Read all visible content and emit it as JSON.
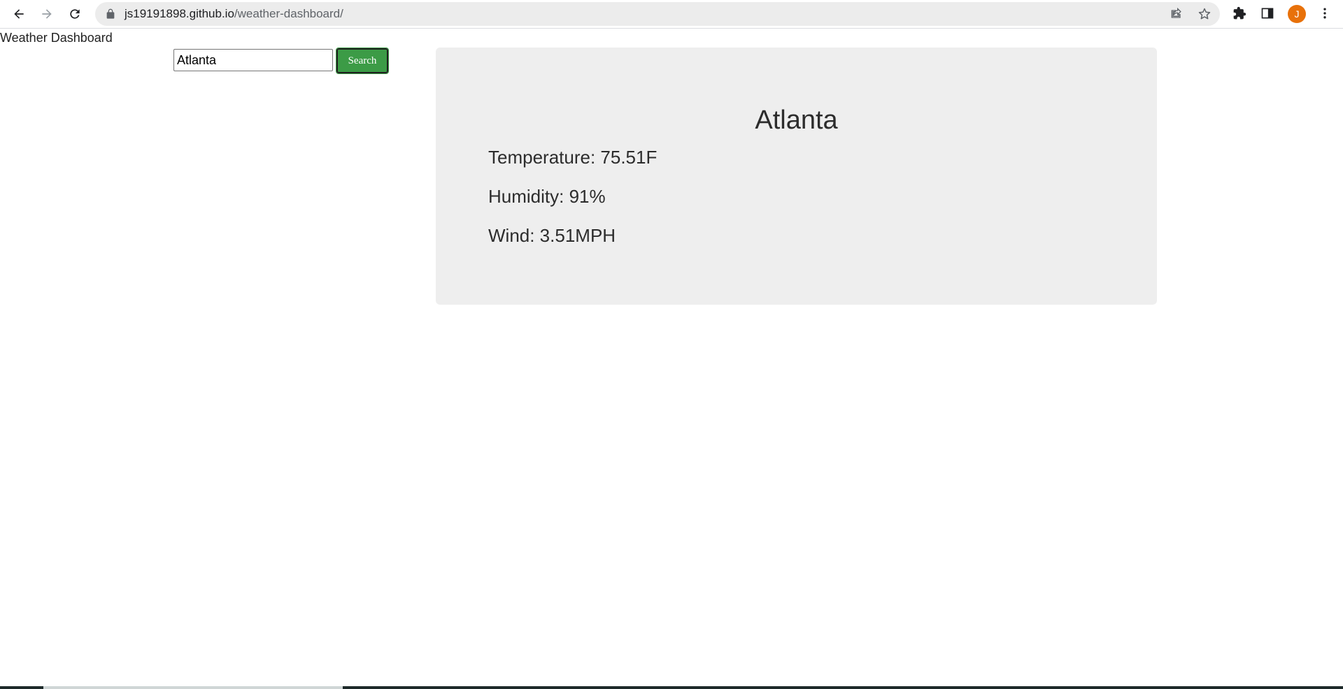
{
  "browser": {
    "url_host": "js19191898.github.io",
    "url_path": "/weather-dashboard/",
    "profile_initial": "J",
    "profile_color": "#e8710a"
  },
  "page": {
    "title": "Weather Dashboard"
  },
  "search": {
    "value": "Atlanta",
    "button_label": "Search",
    "button_color": "#3c9b46"
  },
  "weather": {
    "city": "Atlanta",
    "temperature": "Temperature: 75.51F",
    "humidity": "Humidity: 91%",
    "wind": "Wind: 3.51MPH",
    "card_color": "#eeeeee"
  }
}
